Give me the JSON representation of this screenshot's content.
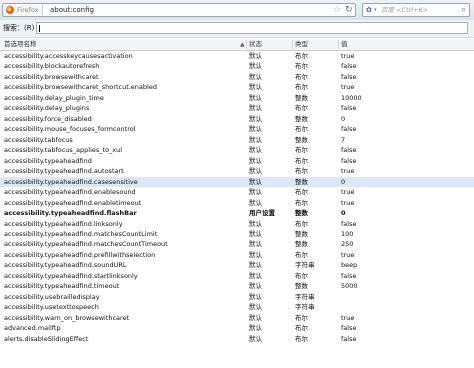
{
  "toolbar": {
    "identity_label": "Firefox",
    "url": "about:config",
    "search_placeholder": "百度 <Ctrl+K>"
  },
  "filter": {
    "label": "搜索：(R)",
    "value": ""
  },
  "columns": {
    "name": "首选项名称",
    "status": "状态",
    "type": "类型",
    "value": "值"
  },
  "rows": [
    {
      "name": "accessibility.accesskeycausesactivation",
      "status": "默认",
      "type": "布尔",
      "value": "true"
    },
    {
      "name": "accessibility.blockautorefresh",
      "status": "默认",
      "type": "布尔",
      "value": "false"
    },
    {
      "name": "accessibility.browsewithcaret",
      "status": "默认",
      "type": "布尔",
      "value": "false"
    },
    {
      "name": "accessibility.browsewithcaret_shortcut.enabled",
      "status": "默认",
      "type": "布尔",
      "value": "true"
    },
    {
      "name": "accessibility.delay_plugin_time",
      "status": "默认",
      "type": "整数",
      "value": "10000"
    },
    {
      "name": "accessibility.delay_plugins",
      "status": "默认",
      "type": "布尔",
      "value": "false"
    },
    {
      "name": "accessibility.force_disabled",
      "status": "默认",
      "type": "整数",
      "value": "0"
    },
    {
      "name": "accessibility.mouse_focuses_formcontrol",
      "status": "默认",
      "type": "布尔",
      "value": "false"
    },
    {
      "name": "accessibility.tabfocus",
      "status": "默认",
      "type": "整数",
      "value": "7"
    },
    {
      "name": "accessibility.tabfocus_applies_to_xul",
      "status": "默认",
      "type": "布尔",
      "value": "false"
    },
    {
      "name": "accessibility.typeaheadfind",
      "status": "默认",
      "type": "布尔",
      "value": "false"
    },
    {
      "name": "accessibility.typeaheadfind.autostart",
      "status": "默认",
      "type": "布尔",
      "value": "true"
    },
    {
      "name": "accessibility.typeaheadfind.casesensitive",
      "status": "默认",
      "type": "整数",
      "value": "0"
    },
    {
      "name": "accessibility.typeaheadfind.enablesound",
      "status": "默认",
      "type": "布尔",
      "value": "true"
    },
    {
      "name": "accessibility.typeaheadfind.enabletimeout",
      "status": "默认",
      "type": "布尔",
      "value": "true"
    },
    {
      "name": "accessibility.typeaheadfind.flashBar",
      "status": "用户设置",
      "type": "整数",
      "value": "0"
    },
    {
      "name": "accessibility.typeaheadfind.linksonly",
      "status": "默认",
      "type": "布尔",
      "value": "false"
    },
    {
      "name": "accessibility.typeaheadfind.matchesCountLimit",
      "status": "默认",
      "type": "整数",
      "value": "100"
    },
    {
      "name": "accessibility.typeaheadfind.matchesCountTimeout",
      "status": "默认",
      "type": "整数",
      "value": "250"
    },
    {
      "name": "accessibility.typeaheadfind.prefillwithselection",
      "status": "默认",
      "type": "布尔",
      "value": "true"
    },
    {
      "name": "accessibility.typeaheadfind.soundURL",
      "status": "默认",
      "type": "字符串",
      "value": "beep"
    },
    {
      "name": "accessibility.typeaheadfind.startlinksonly",
      "status": "默认",
      "type": "布尔",
      "value": "false"
    },
    {
      "name": "accessibility.typeaheadfind.timeout",
      "status": "默认",
      "type": "整数",
      "value": "5000"
    },
    {
      "name": "accessibility.usebrailledisplay",
      "status": "默认",
      "type": "字符串",
      "value": ""
    },
    {
      "name": "accessibility.usetexttospeech",
      "status": "默认",
      "type": "字符串",
      "value": ""
    },
    {
      "name": "accessibility.warn_on_browsewithcaret",
      "status": "默认",
      "type": "布尔",
      "value": "true"
    },
    {
      "name": "advanced.mailftp",
      "status": "默认",
      "type": "布尔",
      "value": "false"
    },
    {
      "name": "alerts.disableSlidingEffect",
      "status": "默认",
      "type": "布尔",
      "value": "false"
    }
  ],
  "selected_row": 12,
  "user_set_row": 15
}
